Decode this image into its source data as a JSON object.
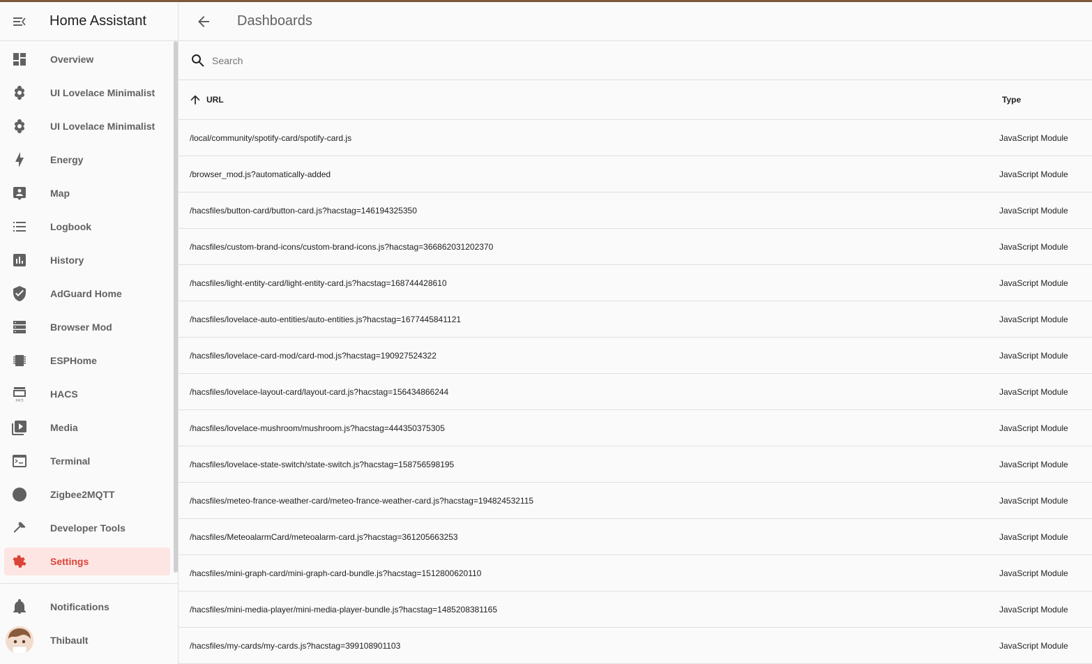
{
  "app": {
    "title": "Home Assistant"
  },
  "sidebar": {
    "items": [
      {
        "label": "Overview",
        "icon": "dashboard-icon"
      },
      {
        "label": "UI Lovelace Minimalist",
        "icon": "flower-icon"
      },
      {
        "label": "UI Lovelace Minimalist",
        "icon": "flower-icon"
      },
      {
        "label": "Energy",
        "icon": "lightning-bolt-icon"
      },
      {
        "label": "Map",
        "icon": "map-account-icon"
      },
      {
        "label": "Logbook",
        "icon": "format-list-icon"
      },
      {
        "label": "History",
        "icon": "chart-box-icon"
      },
      {
        "label": "AdGuard Home",
        "icon": "shield-check-icon"
      },
      {
        "label": "Browser Mod",
        "icon": "server-icon"
      },
      {
        "label": "ESPHome",
        "icon": "chip-icon"
      },
      {
        "label": "HACS",
        "icon": "hacs-icon"
      },
      {
        "label": "Media",
        "icon": "play-box-multiple-icon"
      },
      {
        "label": "Terminal",
        "icon": "console-icon"
      },
      {
        "label": "Zigbee2MQTT",
        "icon": "zigbee-icon"
      },
      {
        "label": "Developer Tools",
        "icon": "hammer-icon"
      },
      {
        "label": "Settings",
        "icon": "cog-icon",
        "active": true
      }
    ],
    "notifications": "Notifications",
    "user": "Thibault"
  },
  "toolbar": {
    "title": "Dashboards"
  },
  "search": {
    "placeholder": "Search"
  },
  "table": {
    "columns": {
      "url": "URL",
      "type": "Type"
    },
    "rows": [
      {
        "url": "/local/community/spotify-card/spotify-card.js",
        "type": "JavaScript Module"
      },
      {
        "url": "/browser_mod.js?automatically-added",
        "type": "JavaScript Module"
      },
      {
        "url": "/hacsfiles/button-card/button-card.js?hacstag=146194325350",
        "type": "JavaScript Module"
      },
      {
        "url": "/hacsfiles/custom-brand-icons/custom-brand-icons.js?hacstag=366862031202370",
        "type": "JavaScript Module"
      },
      {
        "url": "/hacsfiles/light-entity-card/light-entity-card.js?hacstag=168744428610",
        "type": "JavaScript Module"
      },
      {
        "url": "/hacsfiles/lovelace-auto-entities/auto-entities.js?hacstag=1677445841121",
        "type": "JavaScript Module"
      },
      {
        "url": "/hacsfiles/lovelace-card-mod/card-mod.js?hacstag=190927524322",
        "type": "JavaScript Module"
      },
      {
        "url": "/hacsfiles/lovelace-layout-card/layout-card.js?hacstag=156434866244",
        "type": "JavaScript Module"
      },
      {
        "url": "/hacsfiles/lovelace-mushroom/mushroom.js?hacstag=444350375305",
        "type": "JavaScript Module"
      },
      {
        "url": "/hacsfiles/lovelace-state-switch/state-switch.js?hacstag=158756598195",
        "type": "JavaScript Module"
      },
      {
        "url": "/hacsfiles/meteo-france-weather-card/meteo-france-weather-card.js?hacstag=194824532115",
        "type": "JavaScript Module"
      },
      {
        "url": "/hacsfiles/MeteoalarmCard/meteoalarm-card.js?hacstag=361205663253",
        "type": "JavaScript Module"
      },
      {
        "url": "/hacsfiles/mini-graph-card/mini-graph-card-bundle.js?hacstag=1512800620110",
        "type": "JavaScript Module"
      },
      {
        "url": "/hacsfiles/mini-media-player/mini-media-player-bundle.js?hacstag=1485208381165",
        "type": "JavaScript Module"
      },
      {
        "url": "/hacsfiles/my-cards/my-cards.js?hacstag=399108901103",
        "type": "JavaScript Module"
      }
    ]
  },
  "colors": {
    "accent": "#db4437",
    "active_bg": "#fde5e3",
    "top_bar": "#7a5a3a"
  }
}
